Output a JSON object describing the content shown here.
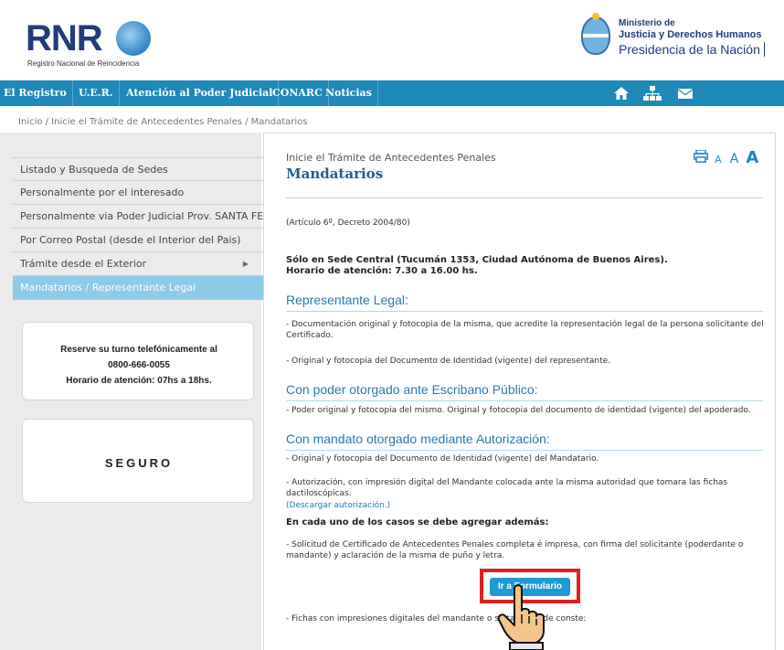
{
  "header": {
    "logo_text": "RNR",
    "logo_subtitle": "Registro Nacional de Reincidencia",
    "ministry_line1": "Ministerio de",
    "ministry_line2": "Justicia y Derechos Humanos",
    "ministry_line3": "Presidencia de la Nación"
  },
  "nav": {
    "items": [
      "El Registro",
      "U.E.R.",
      "Atención al Poder Judicial",
      "CONARC",
      "Noticias"
    ],
    "icons": [
      "home-icon",
      "sitemap-icon",
      "mail-icon"
    ],
    "color": "#1e88b8"
  },
  "breadcrumb": "Inicio / Inicie el Trámite de Antecedentes Penales / Mandatarios",
  "sidebar": {
    "items": [
      "Listado y Busqueda de Sedes",
      "Personalmente por el interesado",
      "Personalmente via Poder Judicial Prov. SANTA FE",
      "Por Correo Postal (desde el Interior del Pais)",
      "Trámite desde el Exterior",
      "Mandatarios / Representante Legal"
    ],
    "active_index": 5,
    "phone_box": {
      "line1": "Reserve su turno telefónicamente al",
      "line2": "0800-666-0055",
      "line3": "Horario de atención: 07hs a 18hs."
    },
    "seguro_label": "SEGURO"
  },
  "main": {
    "subtitle": "Inicie el Trámite de Antecedentes Penales",
    "title": "Mandatarios",
    "font_tools": [
      "A",
      "A",
      "A"
    ],
    "article": "(Artículo 6º, Decreto 2004/80)",
    "location_line1": "Sólo en Sede Central (Tucumán 1353, Ciudad Autónoma de Buenos Aires).",
    "location_line2": "Horario de atención: 7.30 a 16.00 hs.",
    "sec1_title": "Representante Legal:",
    "sec1_p1": "- Documentación original y fotocopia de la misma, que acredite la representación legal de la persona solicitante del Certificado.",
    "sec1_p2": "- Original y fotocopia del Documento de Identidad (vigente) del representante.",
    "sec2_title": "Con poder otorgado ante Escribano Público:",
    "sec2_p1": "- Poder original y fotocopia del mismo. Original y fotocopia del documento de identidad (vigente) del apoderado.",
    "sec3_title": "Con mandato otorgado mediante Autorización:",
    "sec3_p1": "- Original y fotocopia del Documento de Identidad (vigente) del Mandatario.",
    "sec3_p2": "- Autorización, con impresión digital del Mandante colocada ante la misma autoridad que tomara las fichas dactiloscópicas.",
    "download_link": "(Descargar autorización.)",
    "all_cases": "En cada uno de los casos se debe agregar además:",
    "request_text": "- Solicitud de Certificado de Antecedentes Penales completa é impresa, con firma del solicitante (poderdante o mandante) y aclaración de la misma de puño y letra.",
    "button_label": "Ir a Formulario",
    "fichas_text": "- Fichas con impresiones digitales del mandante o se              tado donde conste:"
  }
}
